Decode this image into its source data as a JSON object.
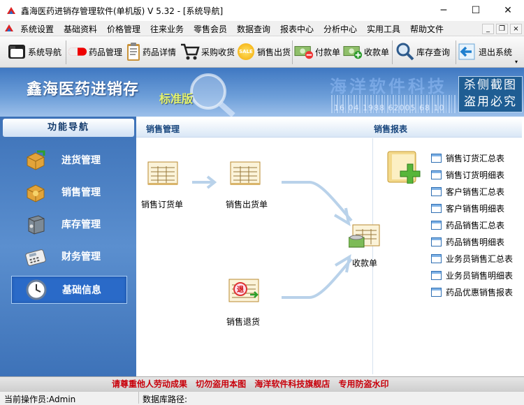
{
  "window": {
    "title": "鑫海医药进销存管理软件(单机版) V 5.32 - [系统导航]",
    "minimize": "─",
    "maximize": "☐",
    "close": "✕"
  },
  "menu": {
    "items": [
      "系统设置",
      "基础资料",
      "价格管理",
      "往来业务",
      "零售会员",
      "数据查询",
      "报表中心",
      "分析中心",
      "实用工具",
      "帮助文件"
    ],
    "mdi_min": "_",
    "mdi_restore": "❐",
    "mdi_close": "×"
  },
  "toolbar": {
    "items": [
      {
        "label": "系统导航",
        "icon": "folder-icon"
      },
      {
        "label": "药品管理",
        "icon": "pill-icon"
      },
      {
        "label": "药品详情",
        "icon": "clipboard-icon"
      },
      {
        "label": "采购收货",
        "icon": "cart-icon"
      },
      {
        "label": "销售出货",
        "icon": "sale-tag-icon"
      },
      {
        "label": "付款单",
        "icon": "money-minus-icon"
      },
      {
        "label": "收款单",
        "icon": "money-plus-icon"
      },
      {
        "label": "库存查询",
        "icon": "magnifier-icon"
      },
      {
        "label": "退出系统",
        "icon": "exit-arrow-icon"
      }
    ],
    "sale_badge": "SALE"
  },
  "banner": {
    "title": "鑫海医药进销存",
    "edition": "标准版",
    "watermark": "海洋软件科技",
    "barcode_digits": "16 04 1988 62005 68 10",
    "stamp_line1": "杀侧截图",
    "stamp_line2": "盗用必究"
  },
  "nav": {
    "header": "功能导航",
    "items": [
      {
        "label": "进货管理",
        "icon": "box-arrow-in-icon",
        "selected": false
      },
      {
        "label": "销售管理",
        "icon": "box-arrow-out-icon",
        "selected": false
      },
      {
        "label": "库存管理",
        "icon": "safe-icon",
        "selected": false
      },
      {
        "label": "财务管理",
        "icon": "calculator-icon",
        "selected": false
      },
      {
        "label": "基础信息",
        "icon": "clock-icon",
        "selected": true
      }
    ]
  },
  "main": {
    "sales_title": "销售管理",
    "report_title": "销售报表",
    "flow": {
      "order": "销售订货单",
      "ship": "销售出货单",
      "return": "销售退货",
      "return_badge": "退",
      "receipt": "收款单"
    },
    "reports": [
      "销售订货汇总表",
      "销售订货明细表",
      "客户销售汇总表",
      "客户销售明细表",
      "药品销售汇总表",
      "药品销售明细表",
      "业务员销售汇总表",
      "业务员销售明细表",
      "药品优惠销售报表"
    ]
  },
  "footer": {
    "notice": "请尊重他人劳动成果  切勿盗用本图  海洋软件科技旗舰店  专用防盗水印",
    "operator": "当前操作员:Admin",
    "db_path": "数据库路径:"
  },
  "colors": {
    "banner": "#4a82c8",
    "nav": "#4a80c4",
    "accent_text": "#17457d",
    "notice": "#c8000a"
  }
}
